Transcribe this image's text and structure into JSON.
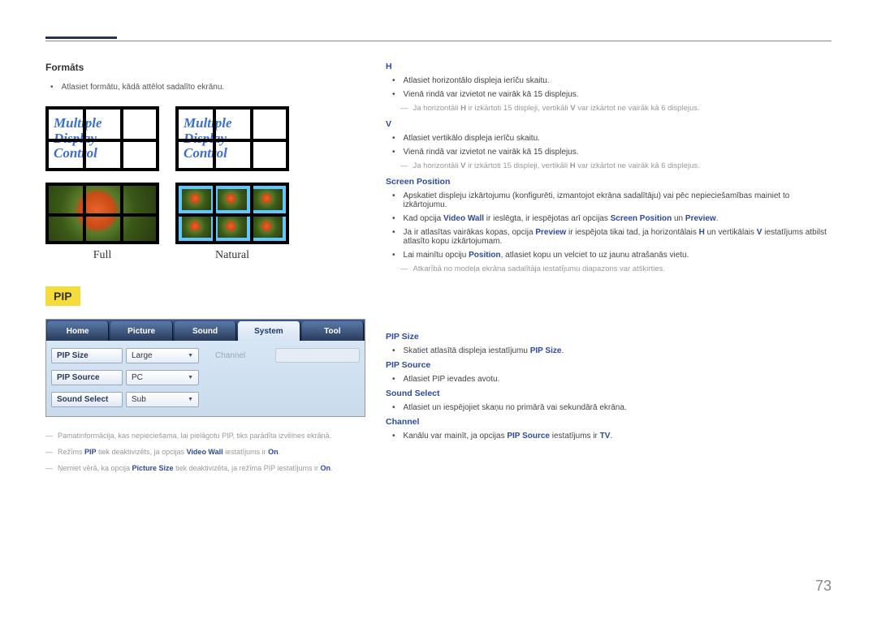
{
  "formats": {
    "title": "Formāts",
    "desc": "Atlasiet formātu, kādā attēlot sadalīto ekrānu.",
    "grid_text_lines": [
      "Multiple",
      "Display",
      "Control"
    ],
    "mode_full": "Full",
    "mode_natural": "Natural"
  },
  "pip": {
    "label": "PIP",
    "tabs": [
      "Home",
      "Picture",
      "Sound",
      "System",
      "Tool"
    ],
    "selected_tab": "System",
    "rows": [
      {
        "label": "PIP Size",
        "value": "Large",
        "disabled_label": "Channel"
      },
      {
        "label": "PIP Source",
        "value": "PC"
      },
      {
        "label": "Sound Select",
        "value": "Sub"
      }
    ],
    "footnotes": [
      {
        "pre": "Pamatinformācija, kas nepieciešama, lai pielāgotu PIP, tiks parādīta izvēlnes ekrānā."
      },
      {
        "pre": "Režīms ",
        "kw1": "PIP",
        "mid": " tiek deaktivizēts, ja opcijas ",
        "kw2": "Video Wall",
        "post": " iestatījums ir ",
        "kw3": "On",
        "tail": "."
      },
      {
        "pre": "Ņemiet vērā, ka opcija ",
        "kw1": "Picture Size",
        "mid": " tiek deaktivizēta, ja režīma PIP iestatījums ir ",
        "kw2": "On",
        "tail": "."
      }
    ]
  },
  "right": {
    "H": {
      "head": "H",
      "bullets": [
        "Atlasiet horizontālo displeja ierīču skaitu.",
        "Vienā rindā var izvietot ne vairāk kā 15 displejus."
      ],
      "note": "Ja horizontāli H ir izkārtoti 15 displeji, vertikāli V var izkārtot ne vairāk kā 6 displejus."
    },
    "V": {
      "head": "V",
      "bullets": [
        "Atlasiet vertikālo displeja ierīču skaitu.",
        "Vienā rindā var izvietot ne vairāk kā 15 displejus."
      ],
      "note": "Ja horizontāli V ir izkārtoti 15 displeji, vertikāli H var izkārtot ne vairāk kā 6 displejus."
    },
    "SP": {
      "head": "Screen Position",
      "b1": "Apskatiet displeju izkārtojumu (konfigurēti, izmantojot ekrāna sadalītāju) vai pēc nepieciešamības mainiet to izkārtojumu.",
      "b2_pre": "Kad opcija ",
      "b2_k1": "Video Wall",
      "b2_mid": " ir ieslēgta, ir iespējotas arī opcijas ",
      "b2_k2": "Screen Position",
      "b2_and": " un ",
      "b2_k3": "Preview",
      "b2_post": ".",
      "b3_pre": "Ja ir atlasītas vairākas kopas, opcija ",
      "b3_k1": "Preview",
      "b3_mid": " ir iespējota tikai tad, ja horizontālais ",
      "b3_k2": "H",
      "b3_mid2": " un vertikālais ",
      "b3_k3": "V",
      "b3_post": " iestatījums atbilst atlasīto kopu izkārtojumam.",
      "b4_pre": "Lai mainītu opciju ",
      "b4_k1": "Position",
      "b4_post": ", atlasiet kopu un velciet to uz jaunu atrašanās vietu.",
      "note": "Atkarībā no modeļa ekrāna sadalītāja iestatījumu diapazons var atšķirties."
    },
    "PIPSize": {
      "head": "PIP Size",
      "b_pre": "Skatiet atlasītā displeja iestatījumu ",
      "b_k": "PIP Size",
      "b_post": "."
    },
    "PIPSource": {
      "head": "PIP Source",
      "b": "Atlasiet PIP ievades avotu."
    },
    "SoundSelect": {
      "head": "Sound Select",
      "b": "Atlasiet un iespējojiet skaņu no primārā vai sekundārā ekrāna."
    },
    "Channel": {
      "head": "Channel",
      "b_pre": "Kanālu var mainīt, ja opcijas ",
      "b_k1": "PIP Source",
      "b_mid": " iestatījums ir ",
      "b_k2": "TV",
      "b_post": "."
    }
  },
  "page_number": "73"
}
